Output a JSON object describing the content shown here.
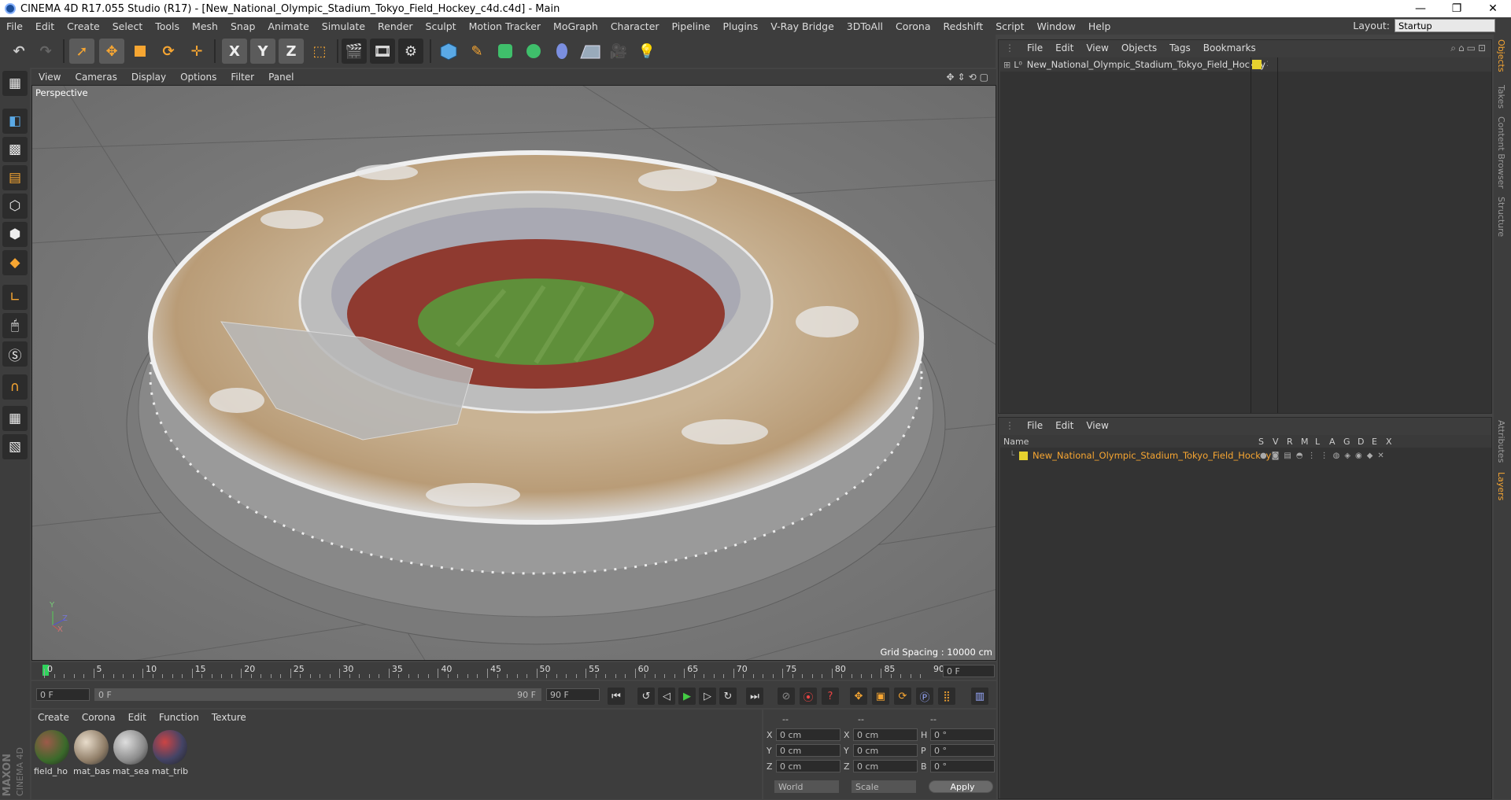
{
  "window": {
    "title": "CINEMA 4D R17.055 Studio (R17) - [New_National_Olympic_Stadium_Tokyo_Field_Hockey_c4d.c4d] - Main",
    "minimize": "—",
    "restore": "❐",
    "close": "✕"
  },
  "menubar": {
    "items": [
      "File",
      "Edit",
      "Create",
      "Select",
      "Tools",
      "Mesh",
      "Snap",
      "Animate",
      "Simulate",
      "Render",
      "Sculpt",
      "Motion Tracker",
      "MoGraph",
      "Character",
      "Pipeline",
      "Plugins",
      "V-Ray Bridge",
      "3DToAll",
      "Corona",
      "Redshift",
      "Script",
      "Window",
      "Help"
    ],
    "layout_label": "Layout:",
    "layout_value": "Startup"
  },
  "toolbar": {
    "x_label": "X",
    "y_label": "Y",
    "z_label": "Z"
  },
  "viewport": {
    "menu": [
      "View",
      "Cameras",
      "Display",
      "Options",
      "Filter",
      "Panel"
    ],
    "camera": "Perspective",
    "grid_spacing": "Grid Spacing : 10000 cm",
    "axis_y": "Y",
    "axis_z": "Z",
    "axis_x": "X"
  },
  "timeline": {
    "ticks": [
      "0",
      "5",
      "10",
      "15",
      "20",
      "25",
      "30",
      "35",
      "40",
      "45",
      "50",
      "55",
      "60",
      "65",
      "70",
      "75",
      "80",
      "85",
      "90"
    ],
    "current_frame": "0 F",
    "start_field": "0 F",
    "range_start": "0 F",
    "range_end": "90 F",
    "end_field": "90 F"
  },
  "materials": {
    "menu": [
      "Create",
      "Corona",
      "Edit",
      "Function",
      "Texture"
    ],
    "items": [
      {
        "label": "field_ho"
      },
      {
        "label": "mat_bas"
      },
      {
        "label": "mat_sea"
      },
      {
        "label": "mat_trib"
      }
    ]
  },
  "coordinates": {
    "header": [
      "--",
      "--",
      "--"
    ],
    "rows": [
      {
        "a": "X",
        "av": "0 cm",
        "b": "X",
        "bv": "0 cm",
        "c": "H",
        "cv": "0 °"
      },
      {
        "a": "Y",
        "av": "0 cm",
        "b": "Y",
        "bv": "0 cm",
        "c": "P",
        "cv": "0 °"
      },
      {
        "a": "Z",
        "av": "0 cm",
        "b": "Z",
        "bv": "0 cm",
        "c": "B",
        "cv": "0 °"
      }
    ],
    "world": "World",
    "scale": "Scale",
    "apply": "Apply"
  },
  "object_manager": {
    "menu": [
      "File",
      "Edit",
      "View",
      "Objects",
      "Tags",
      "Bookmarks"
    ],
    "object_name": "New_National_Olympic_Stadium_Tokyo_Field_Hockey"
  },
  "layer_manager": {
    "menu": [
      "File",
      "Edit",
      "View"
    ],
    "col_name": "Name",
    "cols": [
      "S",
      "V",
      "R",
      "M",
      "L",
      "A",
      "G",
      "D",
      "E",
      "X"
    ],
    "layer_name": "New_National_Olympic_Stadium_Tokyo_Field_Hockey"
  },
  "right_tabs": {
    "objects": "Objects",
    "takes": "Takes",
    "content_browser": "Content Browser",
    "structure": "Structure",
    "attributes": "Attributes",
    "layers": "Layers"
  },
  "brand": {
    "maxon": "MAXON",
    "cinema": "CINEMA 4D"
  },
  "colors": {
    "accent": "#f7a632",
    "panel": "#3d3d3d",
    "viewport": "#777777"
  }
}
